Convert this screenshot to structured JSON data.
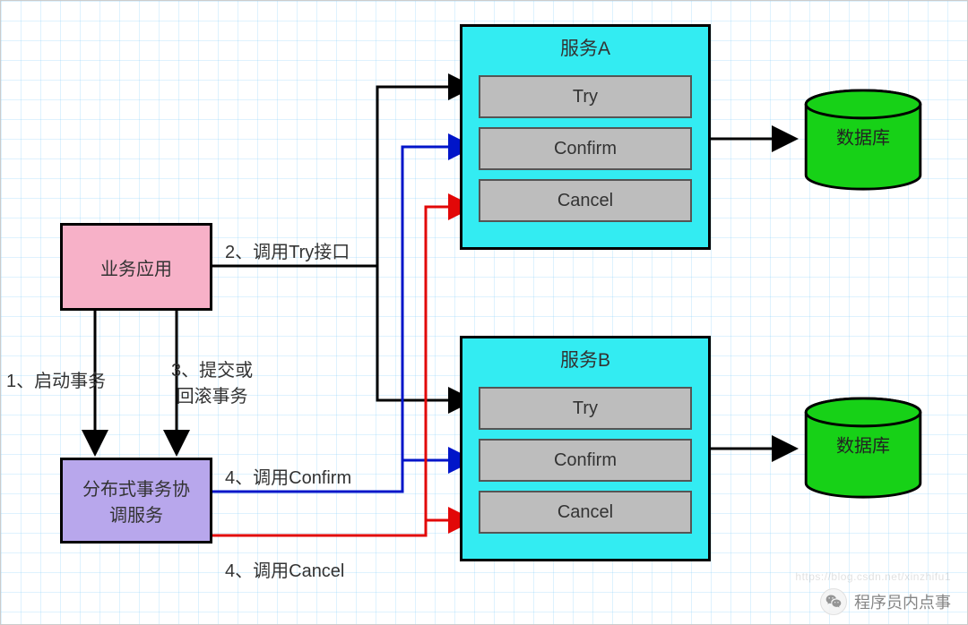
{
  "app": {
    "label": "业务应用"
  },
  "coordinator": {
    "label": "分布式事务协\n调服务"
  },
  "service_a": {
    "title": "服务A",
    "ops": {
      "try": "Try",
      "confirm": "Confirm",
      "cancel": "Cancel"
    }
  },
  "service_b": {
    "title": "服务B",
    "ops": {
      "try": "Try",
      "confirm": "Confirm",
      "cancel": "Cancel"
    }
  },
  "db_a": {
    "label": "数据库"
  },
  "db_b": {
    "label": "数据库"
  },
  "edges": {
    "start_tx": "1、启动事务",
    "call_try": "2、调用Try接口",
    "commit_or_rollback": "3、提交或\n回滚事务",
    "call_confirm": "4、调用Confirm",
    "call_cancel": "4、调用Cancel"
  },
  "watermark": "程序员内点事",
  "faint_watermark": "https://blog.csdn.net/xinzhifu1"
}
